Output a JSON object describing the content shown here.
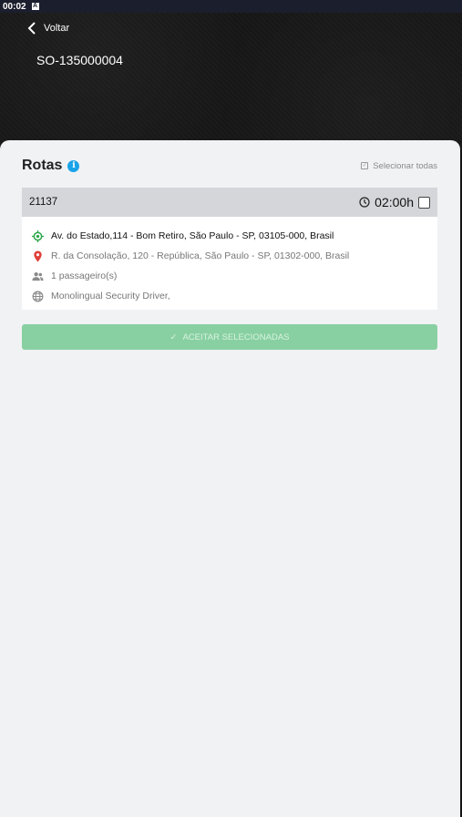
{
  "status_bar": {
    "time": "00:02",
    "notification_icon": "A"
  },
  "header": {
    "back_label": "Voltar",
    "order_id": "SO-135000004"
  },
  "routes_section": {
    "title": "Rotas",
    "info_icon": "info-icon",
    "select_all_label": "Selecionar todas"
  },
  "routes": [
    {
      "number": "21137",
      "time": "02:00h",
      "origin": "Av. do Estado,114 - Bom Retiro, São Paulo - SP, 03105-000, Brasil",
      "destination": "R. da Consolação, 120 - República, São Paulo - SP, 01302-000, Brasil",
      "passengers": "1 passageiro(s)",
      "service": "Monolingual Security Driver,"
    }
  ],
  "accept_button": {
    "label": "ACEITAR SELECIONADAS",
    "enabled": false
  },
  "colors": {
    "accent_green": "#88d0a2",
    "origin_icon": "#2aa84a",
    "destination_icon": "#e0403a",
    "info_blue": "#1aa3e8"
  }
}
